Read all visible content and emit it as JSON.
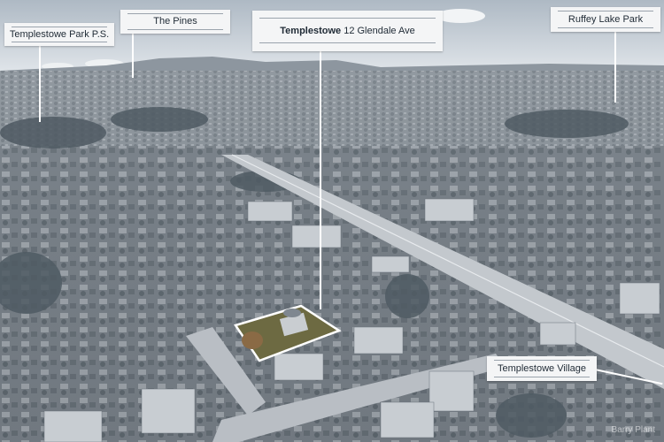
{
  "labels": {
    "park_ps": "Templestowe Park P.S.",
    "pines": "The Pines",
    "main_bold": "Templestowe",
    "main_rest": "12 Glendale Ave",
    "ruffey": "Ruffey Lake Park",
    "village": "Templestowe Village"
  },
  "watermark": "Barry Plant",
  "colors": {
    "sky": "#cfd6dd",
    "suburb": "#7d858c",
    "trees": "#55606a",
    "road": "#b7bcc2",
    "highlight_border": "#ffffff",
    "highlight_fill": "#6b6b3a"
  }
}
